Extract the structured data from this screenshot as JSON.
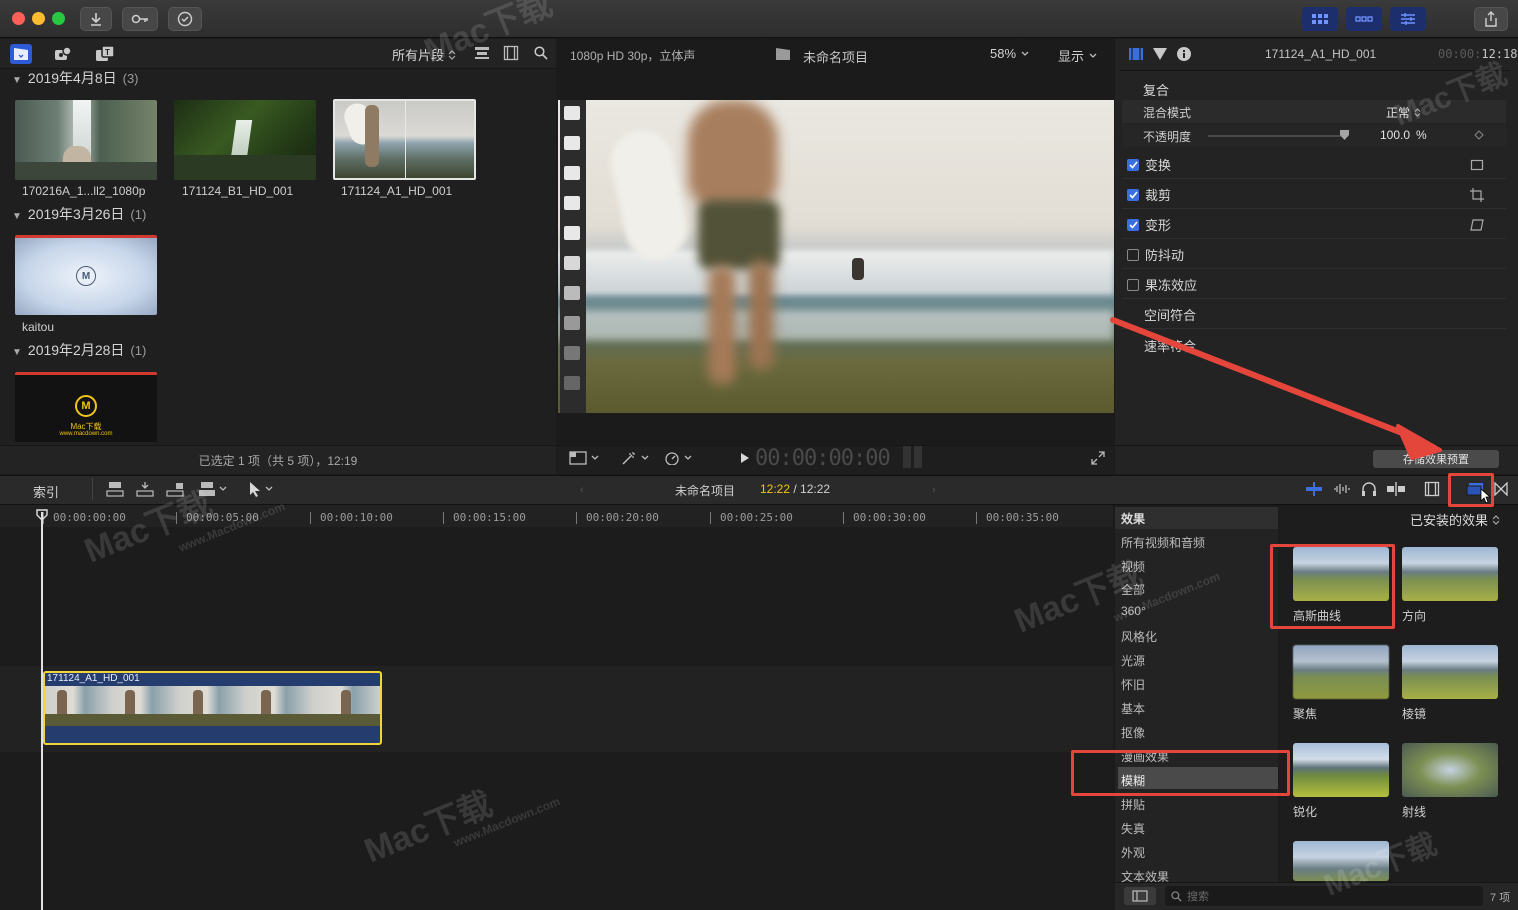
{
  "browser": {
    "filter_label": "所有片段",
    "events": [
      {
        "date": "2019年4月8日",
        "count": "(3)"
      },
      {
        "date": "2019年3月26日",
        "count": "(1)"
      },
      {
        "date": "2019年2月28日",
        "count": "(1)"
      }
    ],
    "clips": [
      {
        "name": "170216A_1...ll2_1080p"
      },
      {
        "name": "171124_B1_HD_001"
      },
      {
        "name": "171124_A1_HD_001"
      },
      {
        "name": "kaitou"
      }
    ],
    "mac_logo_text": "Mac下载",
    "mac_logo_url": "www.macdown.com",
    "status": "已选定 1 项（共 5 项），12:19"
  },
  "viewer": {
    "format": "1080p HD 30p，立体声",
    "project_name": "未命名项目",
    "zoom": "58%",
    "display_label": "显示",
    "timecode": "00:00:00:00"
  },
  "inspector": {
    "clip_name": "171124_A1_HD_001",
    "timecode_prefix": "00:00:",
    "timecode": "12:18",
    "composite_label": "复合",
    "blend_mode_label": "混合模式",
    "blend_mode_value": "正常",
    "opacity_label": "不透明度",
    "opacity_value": "100.0",
    "opacity_unit": "%",
    "opacity_fraction": 1.0,
    "sections": [
      {
        "label": "变换",
        "checked": true
      },
      {
        "label": "裁剪",
        "checked": true
      },
      {
        "label": "变形",
        "checked": true
      },
      {
        "label": "防抖动",
        "checked": false
      },
      {
        "label": "果冻效应",
        "checked": false
      },
      {
        "label": "空间符合",
        "checked": null
      },
      {
        "label": "速率符合",
        "checked": null
      }
    ],
    "save_preset_label": "存储效果预置"
  },
  "timeline": {
    "index_label": "索引",
    "project_name": "未命名项目",
    "current_time": "12:22",
    "separator": " / ",
    "total_time": "12:22",
    "ruler": [
      "00:00:00:00",
      "00:00:05:00",
      "00:00:10:00",
      "00:00:15:00",
      "00:00:20:00",
      "00:00:25:00",
      "00:00:30:00",
      "00:00:35:00"
    ],
    "clip_name": "171124_A1_HD_001"
  },
  "effects": {
    "header": "效果",
    "installed_label": "已安装的效果",
    "categories": [
      "所有视频和音频",
      "视频",
      "全部",
      "360°",
      "风格化",
      "光源",
      "怀旧",
      "基本",
      "抠像",
      "漫画效果",
      "模糊",
      "拼贴",
      "失真",
      "外观",
      "文本效果"
    ],
    "selected_category": "模糊",
    "items": [
      "高斯曲线",
      "方向",
      "聚焦",
      "棱镜",
      "锐化",
      "射线",
      ""
    ],
    "search_placeholder": "搜索",
    "item_count": "7 项"
  },
  "watermark": {
    "brand": "Mac下载",
    "url": "www.Macdown.com"
  },
  "colors": {
    "accent": "#3a6fe0",
    "highlight": "#e5463b",
    "timecode_yellow": "#f0c419",
    "clip_border": "#f3d33a"
  }
}
